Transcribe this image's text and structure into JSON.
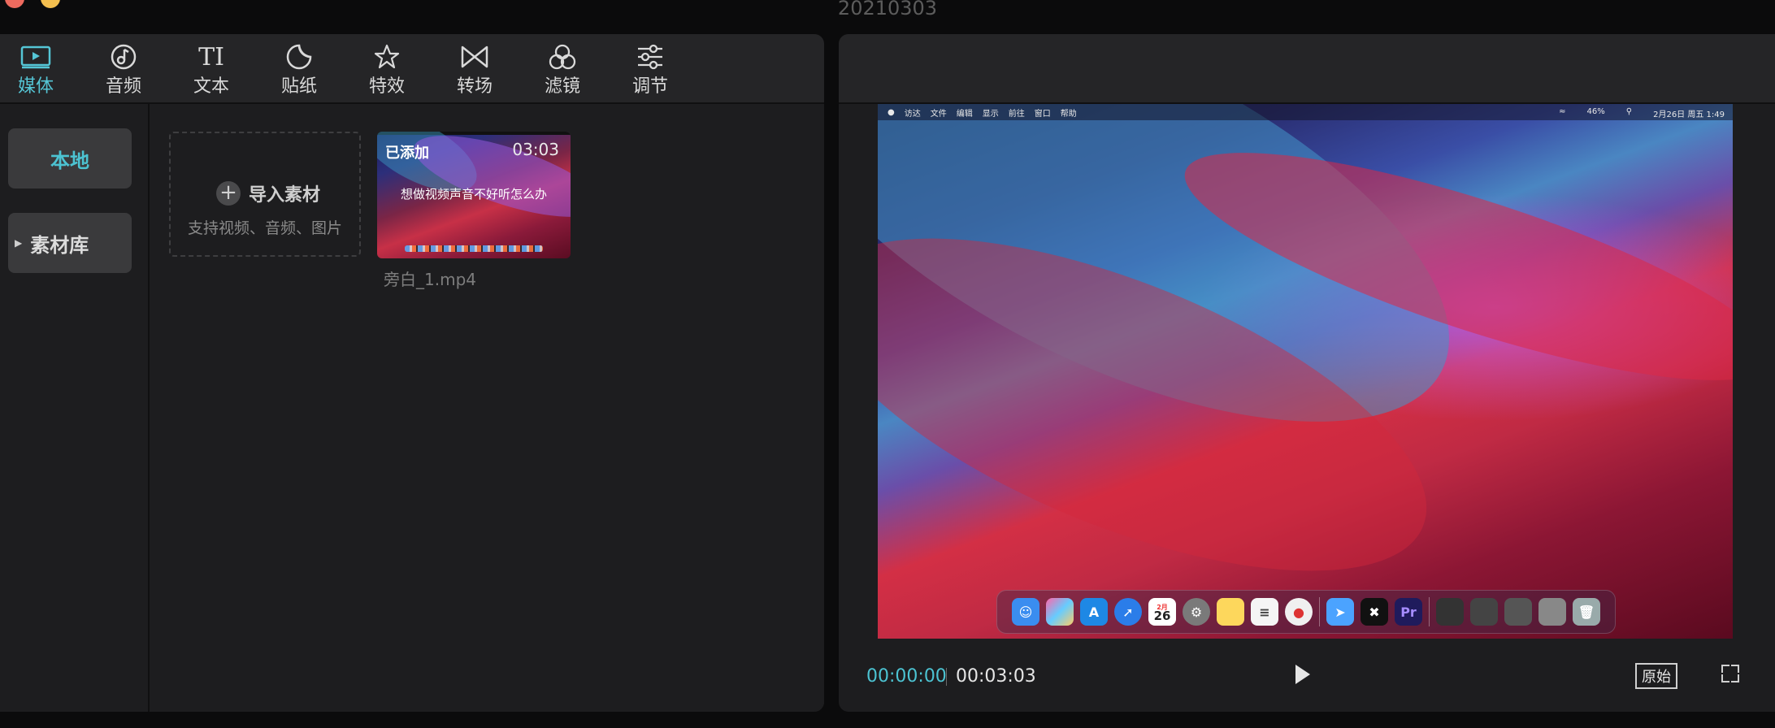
{
  "window": {
    "title": "20210303"
  },
  "toolbar": {
    "tools": [
      {
        "label": "媒体",
        "icon": "media-icon",
        "active": true
      },
      {
        "label": "音频",
        "icon": "audio-icon",
        "active": false
      },
      {
        "label": "文本",
        "icon": "text-icon",
        "active": false
      },
      {
        "label": "贴纸",
        "icon": "sticker-icon",
        "active": false
      },
      {
        "label": "特效",
        "icon": "effects-icon",
        "active": false
      },
      {
        "label": "转场",
        "icon": "transition-icon",
        "active": false
      },
      {
        "label": "滤镜",
        "icon": "filter-icon",
        "active": false
      },
      {
        "label": "调节",
        "icon": "adjust-icon",
        "active": false
      }
    ]
  },
  "sidebar": {
    "items": [
      {
        "label": "本地",
        "active": true
      },
      {
        "label": "素材库",
        "active": false,
        "expandable": true
      }
    ]
  },
  "media": {
    "import": {
      "label": "导入素材",
      "sub": "支持视频、音频、图片"
    },
    "clips": [
      {
        "status": "已添加",
        "duration": "03:03",
        "caption": "想做视频声音不好听怎么办",
        "name": "旁白_1.mp4"
      }
    ]
  },
  "preview": {
    "menubar": {
      "items": [
        "访达",
        "文件",
        "编辑",
        "显示",
        "前往",
        "窗口",
        "帮助"
      ],
      "right": [
        "46%",
        "2月26日 周五 1:49"
      ]
    },
    "dock": {
      "calendar_month": "2月",
      "calendar_day": "26",
      "premiere_label": "Pr"
    },
    "current_time": "00:00:00",
    "total_time": "00:03:03",
    "original_label": "原始"
  },
  "colors": {
    "accent": "#4cc3d2",
    "panel": "#1d1d1f"
  }
}
